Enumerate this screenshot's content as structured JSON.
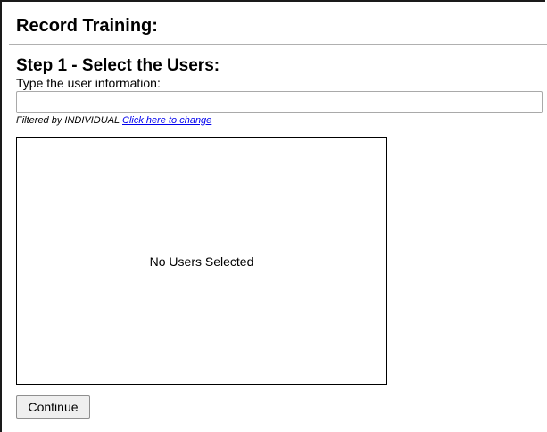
{
  "page": {
    "title": "Record Training:"
  },
  "step1": {
    "heading": "Step 1 - Select the Users:",
    "input_label": "Type the user information:",
    "input_value": "",
    "input_placeholder": "",
    "filter_prefix": "Filtered by INDIVIDUAL",
    "filter_link": "Click here to change"
  },
  "users_list": {
    "empty_text": "No Users Selected"
  },
  "actions": {
    "continue_label": "Continue"
  },
  "colors": {
    "link": "#0000ee",
    "border": "#000000",
    "button_bg": "#efefef"
  }
}
